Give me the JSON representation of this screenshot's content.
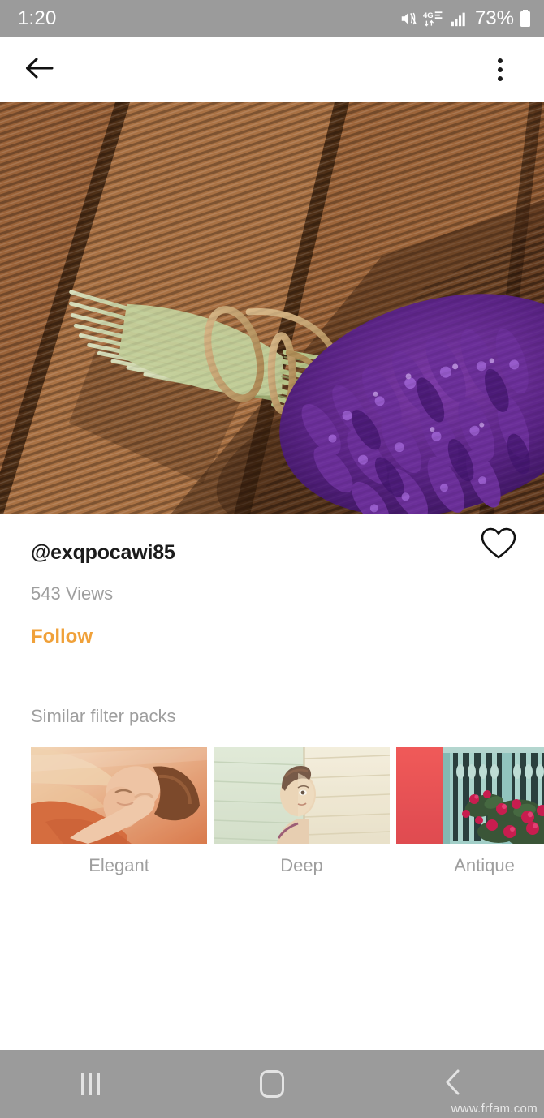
{
  "status_bar": {
    "time": "1:20",
    "battery_percent": "73%",
    "icons": [
      "mute-icon",
      "4g-lte-data-icon",
      "signal-bars-icon",
      "battery-icon"
    ],
    "background_color": "#9b9b9b",
    "text_color": "#ffffff"
  },
  "app_bar": {
    "back_icon": "back-arrow-icon",
    "overflow_icon": "overflow-menu-icon"
  },
  "hero": {
    "alt": "Bouquet of purple lavender tied with twine lying on sunlit wooden decking",
    "subject": "lavender-bouquet",
    "background": "wooden-deck-planks"
  },
  "post": {
    "username": "@exqpocawi85",
    "views": "543 Views",
    "follow_label": "Follow",
    "follow_color": "#f0a13a",
    "like_icon": "heart-outline-icon",
    "liked": false
  },
  "similar": {
    "title": "Similar filter packs",
    "packs": [
      {
        "label": "Elegant",
        "thumb": "warm-orange-portrait-thumbnail",
        "colors": [
          "#e8a07c",
          "#d9693f",
          "#f3d9b6",
          "#c8573a"
        ]
      },
      {
        "label": "Deep",
        "thumb": "pale-green-cream-portrait-thumbnail",
        "colors": [
          "#d7e3cf",
          "#f1e8d4",
          "#c9a88a",
          "#e9e2cc"
        ]
      },
      {
        "label": "Antique",
        "thumb": "red-wall-teal-window-flowers-thumbnail",
        "colors": [
          "#ef4f55",
          "#8fc9c8",
          "#c61a4a",
          "#2c4a3a"
        ]
      }
    ]
  },
  "nav_bar": {
    "recents_icon": "recents-icon",
    "home_icon": "home-icon",
    "back_icon": "nav-back-icon",
    "background_color": "#9b9b9b"
  },
  "watermark": {
    "text": "www.frfam.com"
  }
}
